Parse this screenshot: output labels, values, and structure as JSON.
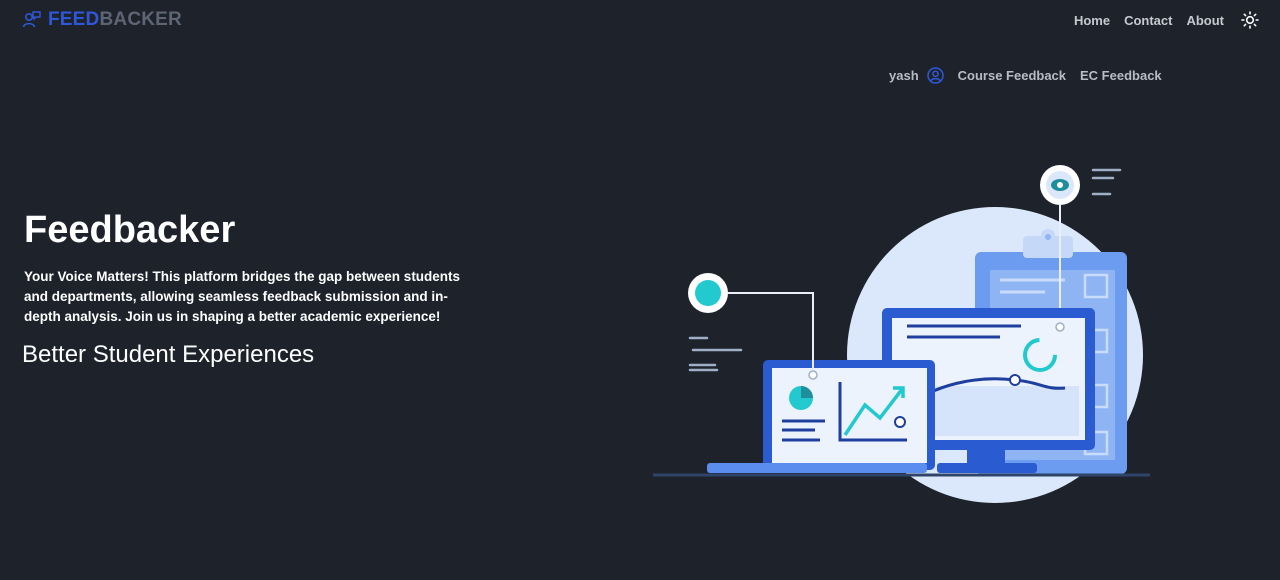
{
  "brand": {
    "part1": "FEED",
    "part2": "BACKER",
    "icon": "users-feedback-icon"
  },
  "nav": {
    "home": "Home",
    "contact": "Contact",
    "about": "About",
    "theme_icon": "sun-icon"
  },
  "subnav": {
    "username": "yash",
    "user_icon": "user-circle-icon",
    "course_feedback": "Course Feedback",
    "ec_feedback": "EC Feedback"
  },
  "hero": {
    "title": "Feedbacker",
    "description": "Your Voice Matters! This platform bridges the gap between students and departments, allowing seamless feedback submission and in-depth analysis. Join us in shaping a better academic experience!",
    "tagline": "Better Student Experiences"
  },
  "colors": {
    "background": "#1d222b",
    "accent": "#2f58d8",
    "muted": "#5d6473",
    "illustration_blue": "#5b8def",
    "illustration_cyan": "#22c9cf"
  }
}
